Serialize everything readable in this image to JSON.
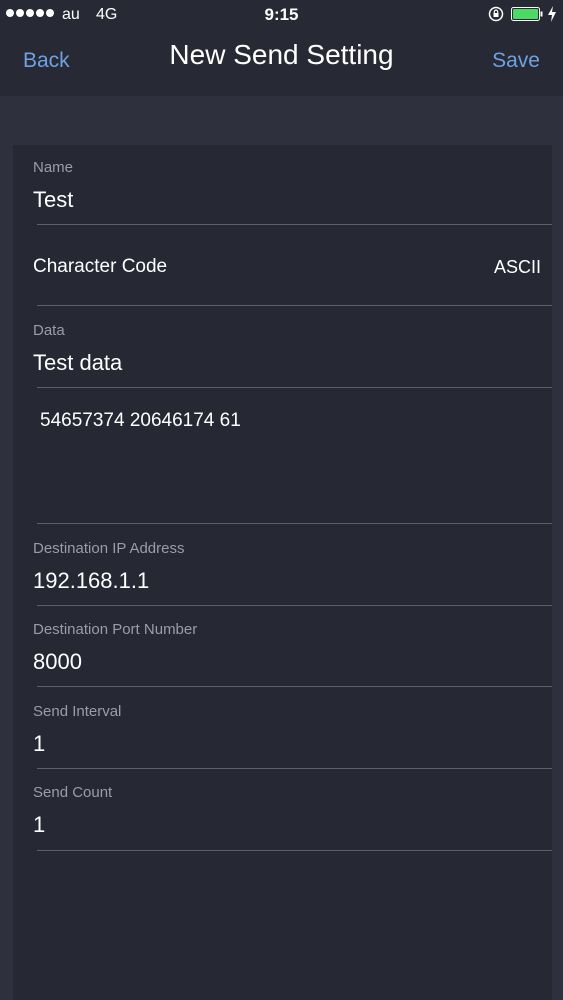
{
  "status_bar": {
    "carrier": "au",
    "network": "4G",
    "time": "9:15",
    "icons": [
      "signal-dots-icon",
      "orientation-lock-icon",
      "battery-icon",
      "charging-bolt-icon"
    ],
    "battery_color": "#4cd964"
  },
  "nav": {
    "back_label": "Back",
    "title": "New Send Setting",
    "save_label": "Save",
    "accent_color": "#6ea2e2"
  },
  "form": {
    "name": {
      "label": "Name",
      "value": "Test"
    },
    "character_code": {
      "label": "Character Code",
      "value": "ASCII"
    },
    "data": {
      "label": "Data",
      "value": "Test data",
      "hex": "54657374 20646174 61"
    },
    "destination_ip": {
      "label": "Destination IP Address",
      "value": "192.168.1.1"
    },
    "destination_port": {
      "label": "Destination Port Number",
      "value": "8000"
    },
    "send_interval": {
      "label": "Send Interval",
      "value": "1"
    },
    "send_count": {
      "label": "Send Count",
      "value": "1"
    }
  }
}
